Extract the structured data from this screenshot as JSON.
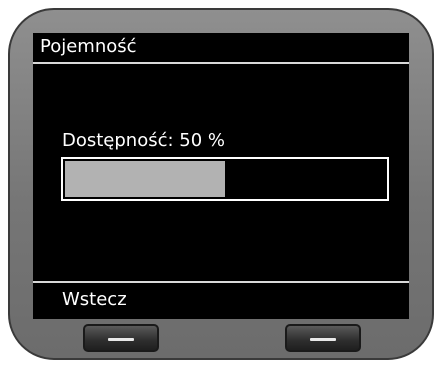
{
  "screen": {
    "title": "Pojemność",
    "status_label": "Dostępność: 50 %",
    "availability_fraction": 0.5
  },
  "softkeys": {
    "left_label": "Wstecz"
  },
  "colors": {
    "bar_fill": "#b2b2b2",
    "screen_background": "#000000",
    "text": "#ffffff"
  }
}
